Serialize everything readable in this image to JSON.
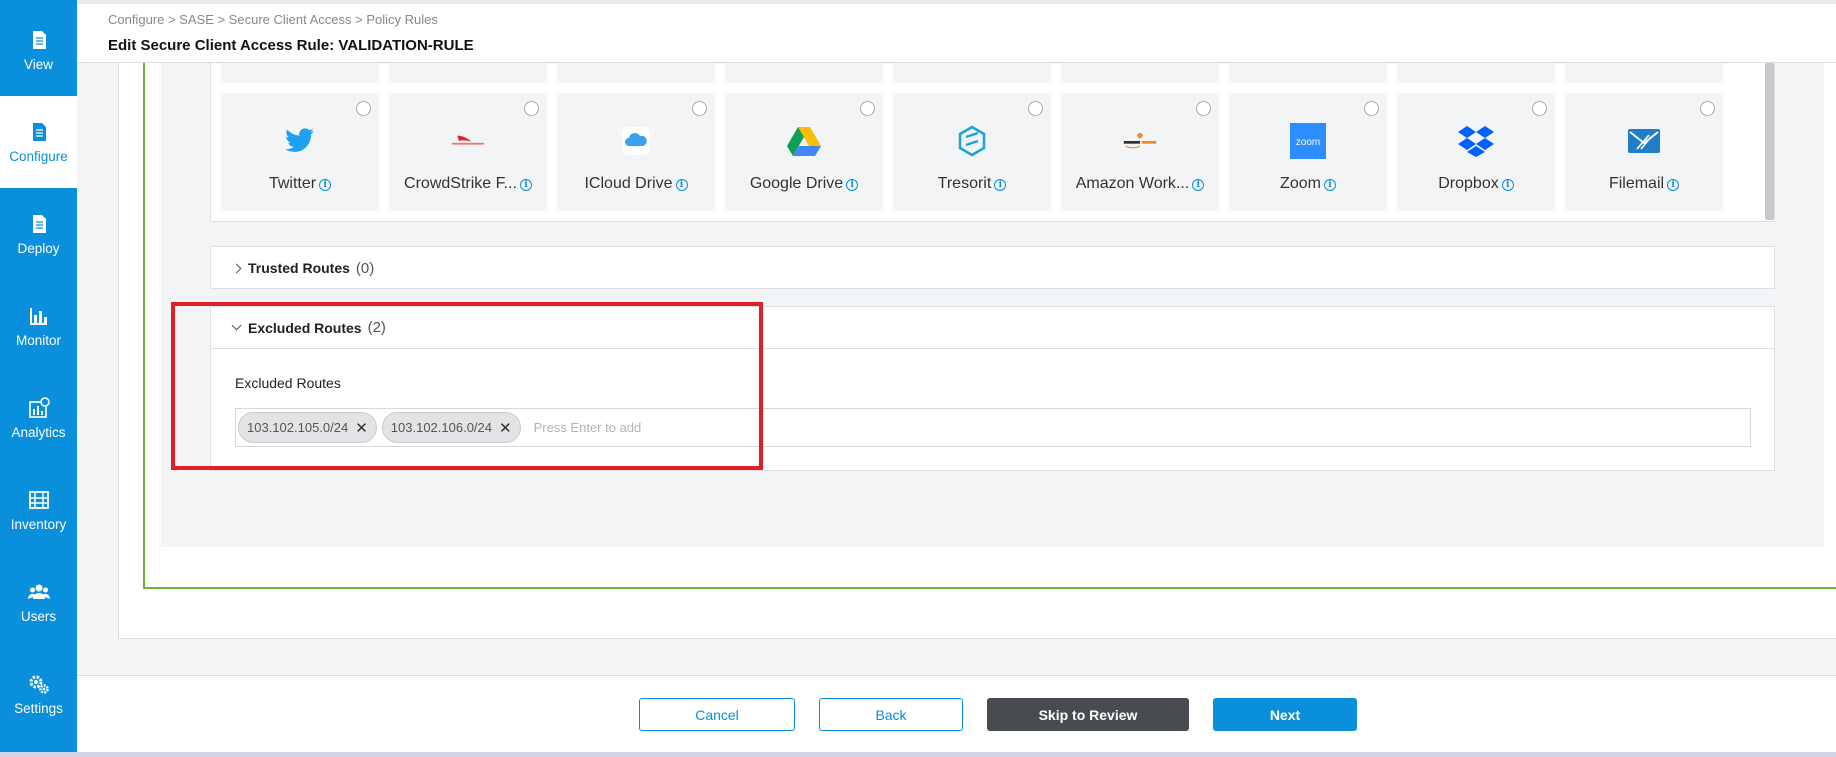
{
  "sidebar": {
    "items": [
      {
        "label": "View",
        "icon": "document-icon"
      },
      {
        "label": "Configure",
        "icon": "document-icon",
        "active": true
      },
      {
        "label": "Deploy",
        "icon": "document-icon"
      },
      {
        "label": "Monitor",
        "icon": "bar-chart-icon"
      },
      {
        "label": "Analytics",
        "icon": "analytics-icon"
      },
      {
        "label": "Inventory",
        "icon": "inventory-icon"
      },
      {
        "label": "Users",
        "icon": "users-icon"
      },
      {
        "label": "Settings",
        "icon": "gears-icon"
      }
    ]
  },
  "header": {
    "breadcrumb": "Configure > SASE > Secure Client Access > Policy Rules",
    "title": "Edit Secure Client Access Rule: VALIDATION-RULE"
  },
  "apps": [
    {
      "name": "Twitter",
      "icon": "twitter-logo"
    },
    {
      "name": "CrowdStrike F...",
      "icon": "crowdstrike-logo"
    },
    {
      "name": "ICloud Drive",
      "icon": "icloud-logo"
    },
    {
      "name": "Google Drive",
      "icon": "google-drive-logo"
    },
    {
      "name": "Tresorit",
      "icon": "tresorit-logo"
    },
    {
      "name": "Amazon Work...",
      "icon": "amazon-workdocs-logo"
    },
    {
      "name": "Zoom",
      "icon": "zoom-logo"
    },
    {
      "name": "Dropbox",
      "icon": "dropbox-logo"
    },
    {
      "name": "Filemail",
      "icon": "filemail-logo"
    }
  ],
  "trusted_routes": {
    "title": "Trusted Routes",
    "count": "(0)"
  },
  "excluded_routes": {
    "title": "Excluded Routes",
    "count": "(2)",
    "field_label": "Excluded Routes",
    "chips": [
      "103.102.105.0/24",
      "103.102.106.0/24"
    ],
    "placeholder": "Press Enter to add"
  },
  "footer": {
    "cancel": "Cancel",
    "back": "Back",
    "skip": "Skip to Review",
    "next": "Next"
  },
  "colors": {
    "accent": "#0a8fdc",
    "highlight": "#e01f26",
    "frame": "#6cb33e"
  }
}
